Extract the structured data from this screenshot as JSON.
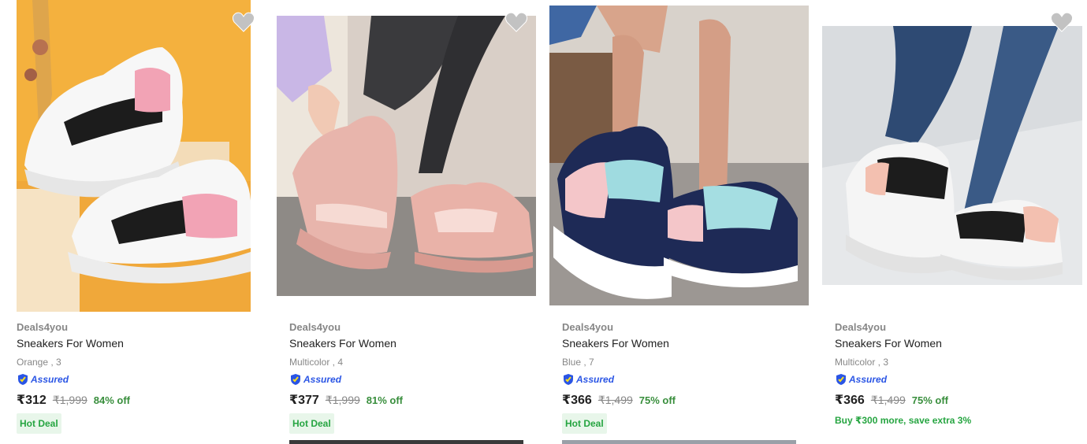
{
  "products": [
    {
      "brand": "Deals4you",
      "title": "Sneakers For Women",
      "variant": "Orange , 3",
      "assured_label": "Assured",
      "price": "₹312",
      "mrp": "₹1,999",
      "discount": "84% off",
      "tag": "Hot Deal",
      "image_alt": "White, black and pink chunky sneakers on yellow background",
      "icon": "heart-icon"
    },
    {
      "brand": "Deals4you",
      "title": "Sneakers For Women",
      "variant": "Multicolor , 4",
      "assured_label": "Assured",
      "price": "₹377",
      "mrp": "₹1,999",
      "discount": "81% off",
      "tag": "Hot Deal",
      "image_alt": "Pink chunky sneakers worn with grey jeans",
      "icon": "heart-icon"
    },
    {
      "brand": "Deals4you",
      "title": "Sneakers For Women",
      "variant": "Blue , 7",
      "assured_label": "Assured",
      "price": "₹366",
      "mrp": "₹1,499",
      "discount": "75% off",
      "tag": "Hot Deal",
      "image_alt": "Navy, aqua and pink sneakers worn on a tiled floor",
      "icon": "heart-icon"
    },
    {
      "brand": "Deals4you",
      "title": "Sneakers For Women",
      "variant": "Multicolor , 3",
      "assured_label": "Assured",
      "price": "₹366",
      "mrp": "₹1,499",
      "discount": "75% off",
      "offer": "Buy ₹300 more, save extra 3%",
      "image_alt": "White, black and peach sneakers worn with blue jeans",
      "icon": "heart-icon"
    }
  ],
  "colors": {
    "price_green": "#388e3c",
    "deal_bg": "#e8f6ea",
    "assured_blue": "#2a55e5",
    "muted_text": "#878787"
  }
}
